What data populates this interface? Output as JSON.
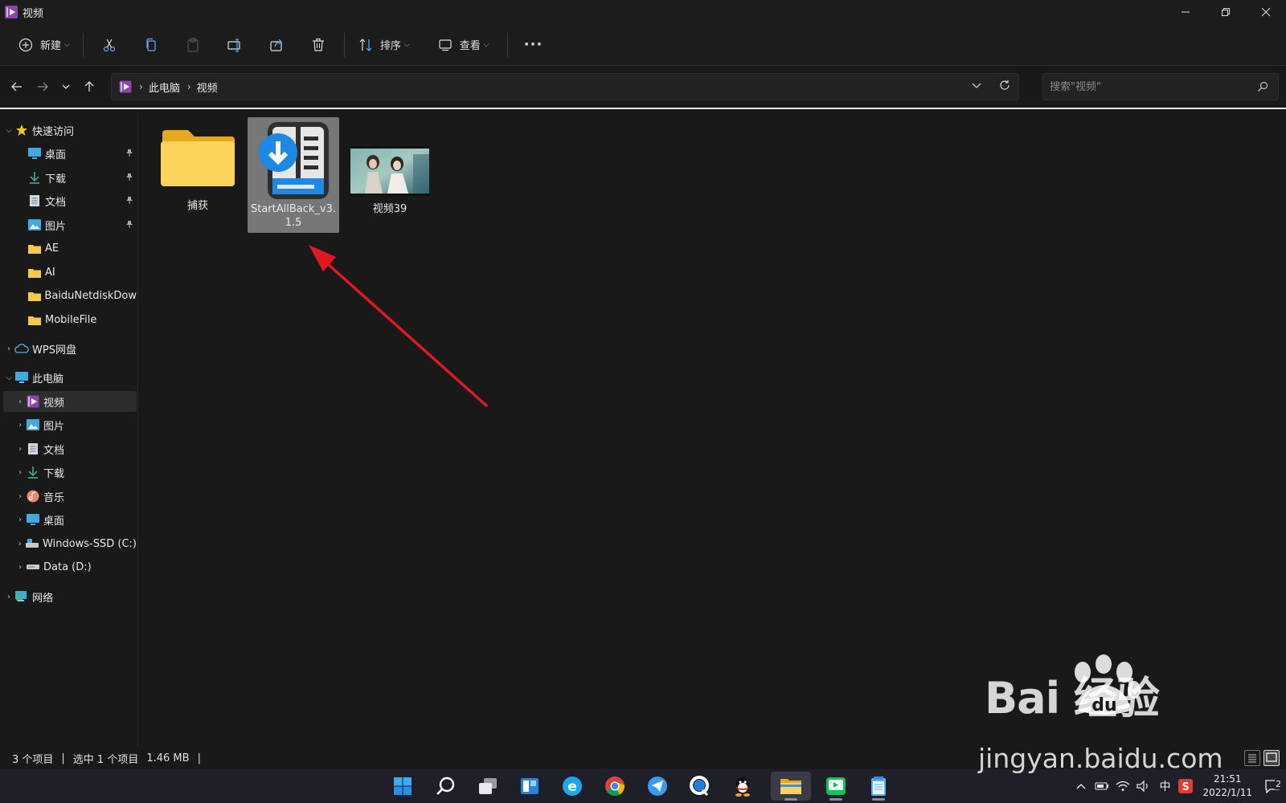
{
  "window": {
    "title": "视频"
  },
  "toolbar": {
    "new_label": "新建",
    "sort_label": "排序",
    "view_label": "查看",
    "more_label": "···"
  },
  "address": {
    "crumbs": [
      "此电脑",
      "视频"
    ],
    "search_placeholder": "搜索\"视频\""
  },
  "sidebar": {
    "quick_access": "快速访问",
    "quick_items": [
      "桌面",
      "下载",
      "文档",
      "图片",
      "AE",
      "AI",
      "BaiduNetdiskDow",
      "MobileFile"
    ],
    "wps": "WPS网盘",
    "this_pc": "此电脑",
    "pc_items": [
      "视频",
      "图片",
      "文档",
      "下载",
      "音乐",
      "桌面",
      "Windows-SSD (C:)",
      "Data (D:)"
    ],
    "network": "网络"
  },
  "files": [
    {
      "name": "捕获",
      "type": "folder"
    },
    {
      "name": "StartAllBack_v3.1.5",
      "type": "installer",
      "selected": true
    },
    {
      "name": "视频39",
      "type": "video"
    }
  ],
  "status": {
    "count": "3 个项目",
    "selection": "选中 1 个项目",
    "size": "1.46 MB"
  },
  "taskbar": {
    "time": "21:51",
    "date": "2022/1/11",
    "ime": "中",
    "notification_count": "2"
  },
  "watermark": {
    "logo_text": "Bai 经验",
    "du_text": "du",
    "url": "jingyan.baidu.com"
  },
  "colors": {
    "background": "#191919",
    "selection": "#777777",
    "accent_blue": "#1e88e5",
    "folder_yellow": "#f7c948",
    "annotation_red": "#e0191e"
  }
}
